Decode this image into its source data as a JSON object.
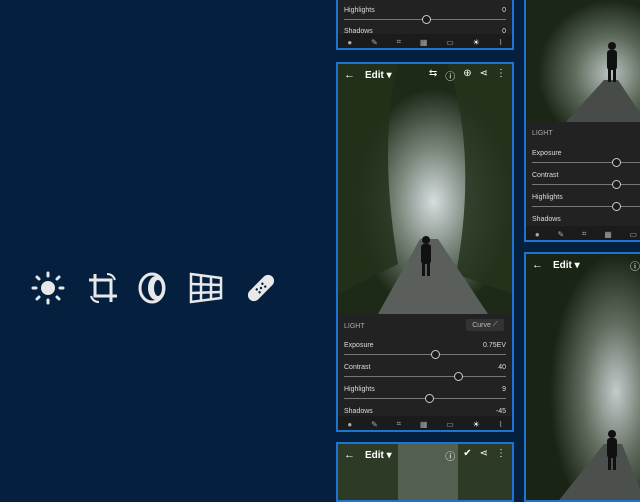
{
  "left_icons": [
    "sun-icon",
    "crop-rotate-icon",
    "optics-lens-icon",
    "geometry-grid-icon",
    "healing-bandage-icon"
  ],
  "screen_top": {
    "sliders": [
      {
        "label": "Highlights",
        "value": "0",
        "position_pct": 50
      },
      {
        "label": "Shadows",
        "value": "0",
        "position_pct": 50
      }
    ]
  },
  "screen_main": {
    "header": {
      "back": "←",
      "title": "Edit ▾",
      "icons": [
        "compare-icon",
        "help-icon",
        "add-icon",
        "share-icon",
        "more-icon"
      ]
    },
    "section_label": "LIGHT",
    "curve_label": "Curve",
    "sliders": [
      {
        "label": "Exposure",
        "value": "0.75EV",
        "position_pct": 56
      },
      {
        "label": "Contrast",
        "value": "40",
        "position_pct": 70
      },
      {
        "label": "Highlights",
        "value": "9",
        "position_pct": 52
      },
      {
        "label": "Shadows",
        "value": "-45",
        "position_pct": 27
      }
    ],
    "tools": [
      "circle-tool-icon",
      "brush-icon",
      "crop-icon",
      "presets-icon",
      "auto-icon",
      "light-icon",
      "healing-icon"
    ]
  },
  "screen_bottom": {
    "header": {
      "back": "←",
      "title": "Edit ▾",
      "icons": [
        "help-icon",
        "check-icon",
        "share-icon",
        "more-icon"
      ]
    }
  },
  "screen_right_top": {
    "section_label": "LIGHT",
    "sliders": [
      {
        "label": "Exposure",
        "value": "",
        "position_pct": 70
      },
      {
        "label": "Contrast",
        "value": "",
        "position_pct": 70
      },
      {
        "label": "Highlights",
        "value": "",
        "position_pct": 70
      },
      {
        "label": "Shadows",
        "value": "",
        "position_pct": 70
      }
    ]
  },
  "screen_right_bottom": {
    "header": {
      "back": "←",
      "title": "Edit ▾"
    }
  }
}
